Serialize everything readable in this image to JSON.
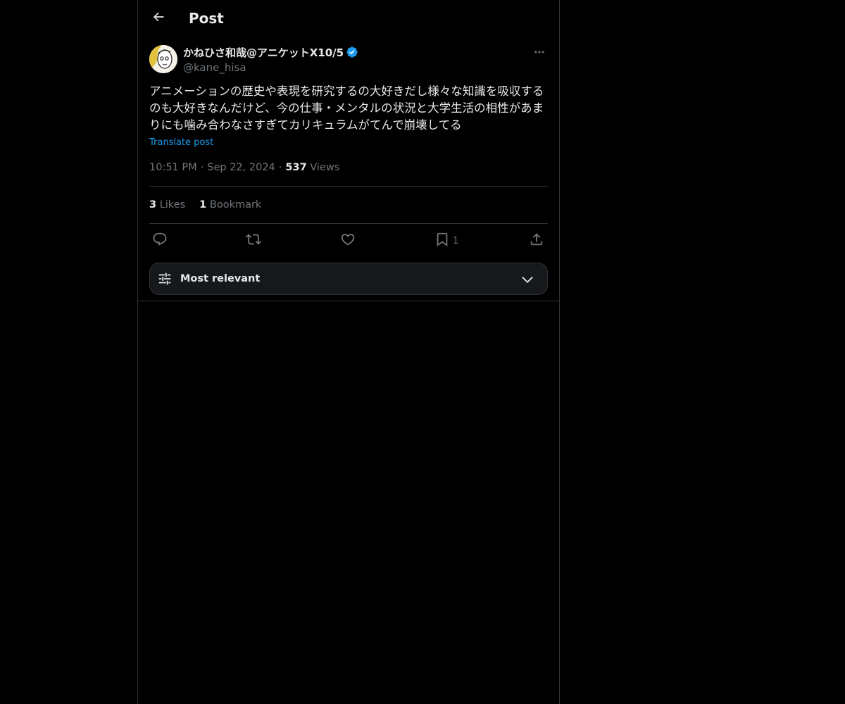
{
  "header": {
    "title": "Post",
    "back_icon": "arrow-left-icon"
  },
  "post": {
    "author": {
      "name": "かねひさ和哉@アニケットX10/5",
      "handle": "@kane_hisa",
      "verified": true,
      "verified_color": "#1d9bf0"
    },
    "text": "アニメーションの歴史や表現を研究するの大好きだし様々な知識を吸収するのも大好きなんだけど、今の仕事・メンタルの状況と大学生活の相性があまりにも噛み合わなさすぎてカリキュラムがてんで崩壊してる",
    "translate_label": "Translate post",
    "time": "10:51 PM",
    "date": "Sep 22, 2024",
    "views_count": "537",
    "views_label": "Views",
    "stats": {
      "likes_count": "3",
      "likes_label": "Likes",
      "bookmarks_count": "1",
      "bookmarks_label": "Bookmark"
    },
    "actions": {
      "reply_icon": "reply-icon",
      "repost_icon": "repost-icon",
      "like_icon": "heart-icon",
      "bookmark_icon": "bookmark-icon",
      "bookmark_count": "1",
      "share_icon": "share-icon"
    }
  },
  "replies_sort": {
    "label": "Most relevant",
    "icon": "sliders-icon",
    "chevron": "chevron-down-icon"
  },
  "colors": {
    "background": "#000000",
    "text_primary": "#e7e9ea",
    "text_secondary": "#71767b",
    "link": "#1d9bf0",
    "border": "#2f3336"
  }
}
